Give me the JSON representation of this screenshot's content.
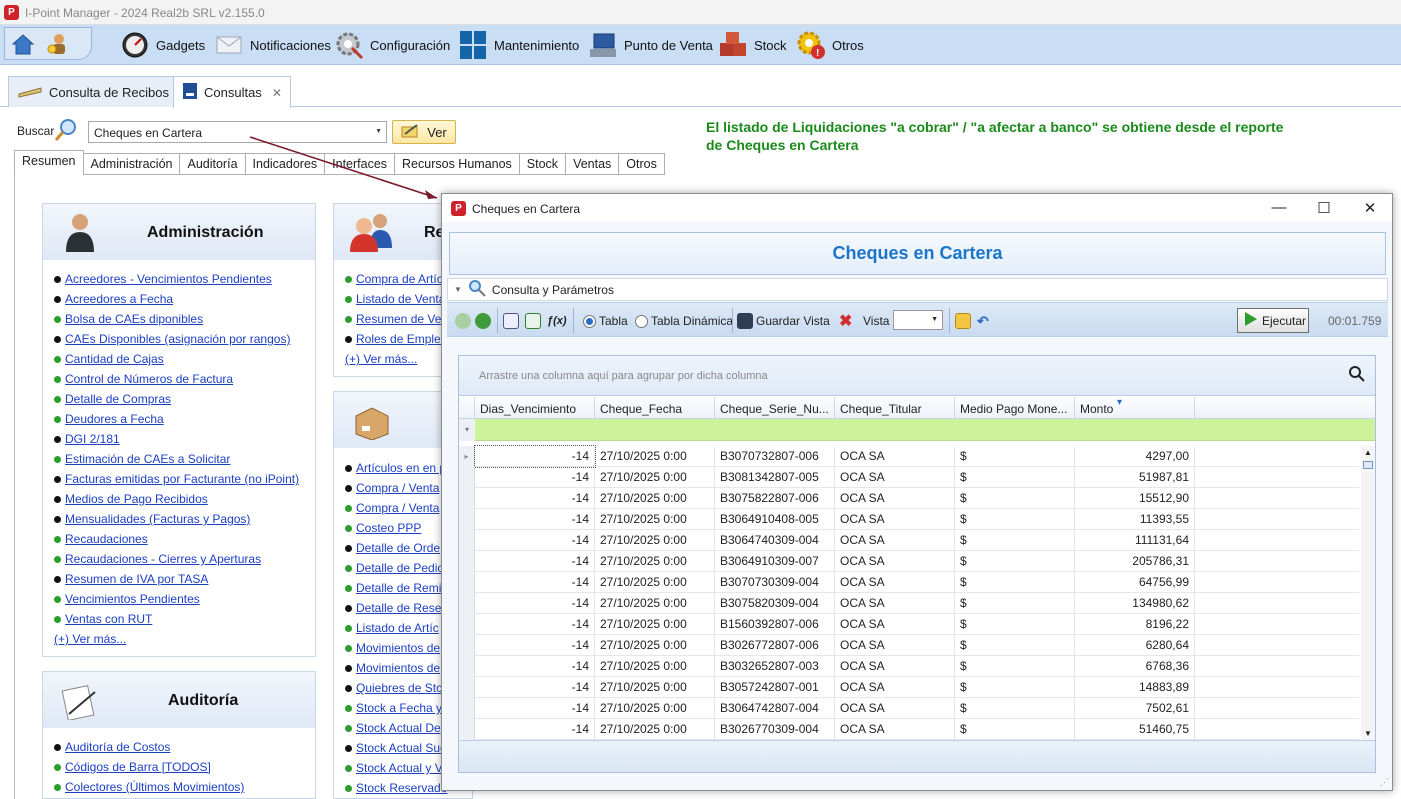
{
  "app": {
    "title": "I-Point Manager - 2024 Real2b SRL v2.155.0"
  },
  "ribbon": {
    "items": [
      {
        "label": "Gadgets",
        "icon": "gauge-icon"
      },
      {
        "label": "Notificaciones",
        "icon": "envelope-icon"
      },
      {
        "label": "Configuración",
        "icon": "gear-wrench-icon"
      },
      {
        "label": "Mantenimiento",
        "icon": "windows-tiles-icon"
      },
      {
        "label": "Punto de Venta",
        "icon": "pos-terminal-icon"
      },
      {
        "label": "Stock",
        "icon": "boxes-icon"
      },
      {
        "label": "Otros",
        "icon": "gear-warning-icon"
      }
    ]
  },
  "doc_tabs": [
    {
      "label": "Consulta de Recibos",
      "close": "✕"
    },
    {
      "label": "Consultas",
      "close": "✕"
    }
  ],
  "search": {
    "label": "Buscar",
    "value": "Cheques en Cartera",
    "button": "Ver"
  },
  "note": "El listado de Liquidaciones \"a cobrar\" / \"a afectar a banco\" se obtiene desde el reporte de Cheques en Cartera",
  "section_tabs": [
    "Resumen",
    "Administración",
    "Auditoría",
    "Indicadores",
    "Interfaces",
    "Recursos Humanos",
    "Stock",
    "Ventas",
    "Otros"
  ],
  "cards": {
    "administracion": {
      "title": "Administración",
      "items": [
        {
          "label": "Acreedores - Vencimientos Pendientes",
          "dot": "k"
        },
        {
          "label": "Acreedores a Fecha",
          "dot": "k"
        },
        {
          "label": "Bolsa de CAEs diponibles",
          "dot": "g"
        },
        {
          "label": "CAEs Disponibles (asignación por rangos)",
          "dot": "k"
        },
        {
          "label": "Cantidad de Cajas",
          "dot": "g"
        },
        {
          "label": "Control de Números de Factura",
          "dot": "g"
        },
        {
          "label": "Detalle de Compras",
          "dot": "g"
        },
        {
          "label": "Deudores a Fecha",
          "dot": "g"
        },
        {
          "label": "DGI 2/181",
          "dot": "k"
        },
        {
          "label": "Estimación de CAEs a Solicitar",
          "dot": "g"
        },
        {
          "label": "Facturas emitidas por Facturante (no iPoint)",
          "dot": "k"
        },
        {
          "label": "Medios de Pago Recibidos",
          "dot": "k"
        },
        {
          "label": "Mensualidades (Facturas y Pagos)",
          "dot": "k"
        },
        {
          "label": "Recaudaciones",
          "dot": "g"
        },
        {
          "label": "Recaudaciones - Cierres y Aperturas",
          "dot": "g"
        },
        {
          "label": "Resumen de IVA por TASA",
          "dot": "k"
        },
        {
          "label": "Vencimientos Pendientes",
          "dot": "g"
        },
        {
          "label": "Ventas con RUT",
          "dot": "g"
        }
      ],
      "more": "(+) Ver más..."
    },
    "recursos": {
      "title": "Re",
      "items": [
        {
          "label": "Compra de Artíc",
          "dot": "g"
        },
        {
          "label": "Listado de Venta",
          "dot": "g"
        },
        {
          "label": "Resumen de Ver",
          "dot": "g"
        },
        {
          "label": "Roles de Emplea",
          "dot": "k"
        }
      ],
      "more": "(+) Ver más..."
    },
    "stock": {
      "items": [
        {
          "label": "Artículos en en p",
          "dot": "k"
        },
        {
          "label": "Compra / Venta",
          "dot": "k"
        },
        {
          "label": "Compra / Venta",
          "dot": "g"
        },
        {
          "label": "Costeo PPP",
          "dot": "g"
        },
        {
          "label": "Detalle de Orde",
          "dot": "k"
        },
        {
          "label": "Detalle de Pedic",
          "dot": "g"
        },
        {
          "label": "Detalle de Remi",
          "dot": "g"
        },
        {
          "label": "Detalle de Reser",
          "dot": "k"
        },
        {
          "label": "Listado de Artíc",
          "dot": "g"
        },
        {
          "label": "Movimientos de",
          "dot": "g"
        },
        {
          "label": "Movimientos de",
          "dot": "k"
        },
        {
          "label": "Quiebres de Sto",
          "dot": "k"
        },
        {
          "label": "Stock a Fecha y",
          "dot": "g"
        },
        {
          "label": "Stock Actual Dep",
          "dot": "g"
        },
        {
          "label": "Stock Actual Suc",
          "dot": "k"
        },
        {
          "label": "Stock Actual y V",
          "dot": "g"
        },
        {
          "label": "Stock Reservado",
          "dot": "g"
        }
      ]
    },
    "auditoria": {
      "title": "Auditoría",
      "items": [
        {
          "label": "Auditoría de Costos",
          "dot": "k"
        },
        {
          "label": "Códigos de Barra [TODOS]",
          "dot": "g"
        },
        {
          "label": "Colectores (Últimos Movimientos)",
          "dot": "g"
        }
      ]
    }
  },
  "dialog": {
    "title": "Cheques en Cartera",
    "banner": "Cheques en Cartera",
    "consulta": "Consulta y Parámetros",
    "toolbar": {
      "tabla": "Tabla",
      "tabla_dinamica": "Tabla Dinámica",
      "guardar": "Guardar Vista",
      "vista": "Vista",
      "vista_value": "",
      "ejecutar": "Ejecutar",
      "timer": "00:01.759"
    },
    "grid": {
      "group_hint": "Arrastre una columna aquí para agrupar por dicha columna",
      "columns": [
        "Dias_Vencimiento",
        "Cheque_Fecha",
        "Cheque_Serie_Nu...",
        "Cheque_Titular",
        "Medio Pago Mone...",
        "Monto"
      ],
      "rows": [
        [
          "-14",
          "27/10/2025 0:00",
          "B3070732807-006",
          "OCA SA",
          "$",
          "4297,00"
        ],
        [
          "-14",
          "27/10/2025 0:00",
          "B3081342807-005",
          "OCA SA",
          "$",
          "51987,81"
        ],
        [
          "-14",
          "27/10/2025 0:00",
          "B3075822807-006",
          "OCA SA",
          "$",
          "15512,90"
        ],
        [
          "-14",
          "27/10/2025 0:00",
          "B3064910408-005",
          "OCA SA",
          "$",
          "11393,55"
        ],
        [
          "-14",
          "27/10/2025 0:00",
          "B3064740309-004",
          "OCA SA",
          "$",
          "111131,64"
        ],
        [
          "-14",
          "27/10/2025 0:00",
          "B3064910309-007",
          "OCA SA",
          "$",
          "205786,31"
        ],
        [
          "-14",
          "27/10/2025 0:00",
          "B3070730309-004",
          "OCA SA",
          "$",
          "64756,99"
        ],
        [
          "-14",
          "27/10/2025 0:00",
          "B3075820309-004",
          "OCA SA",
          "$",
          "134980,62"
        ],
        [
          "-14",
          "27/10/2025 0:00",
          "B1560392807-006",
          "OCA SA",
          "$",
          "8196,22"
        ],
        [
          "-14",
          "27/10/2025 0:00",
          "B3026772807-006",
          "OCA SA",
          "$",
          "6280,64"
        ],
        [
          "-14",
          "27/10/2025 0:00",
          "B3032652807-003",
          "OCA SA",
          "$",
          "6768,36"
        ],
        [
          "-14",
          "27/10/2025 0:00",
          "B3057242807-001",
          "OCA SA",
          "$",
          "14883,89"
        ],
        [
          "-14",
          "27/10/2025 0:00",
          "B3064742807-004",
          "OCA SA",
          "$",
          "7502,61"
        ],
        [
          "-14",
          "27/10/2025 0:00",
          "B3026770309-004",
          "OCA SA",
          "$",
          "51460,75"
        ]
      ]
    }
  }
}
